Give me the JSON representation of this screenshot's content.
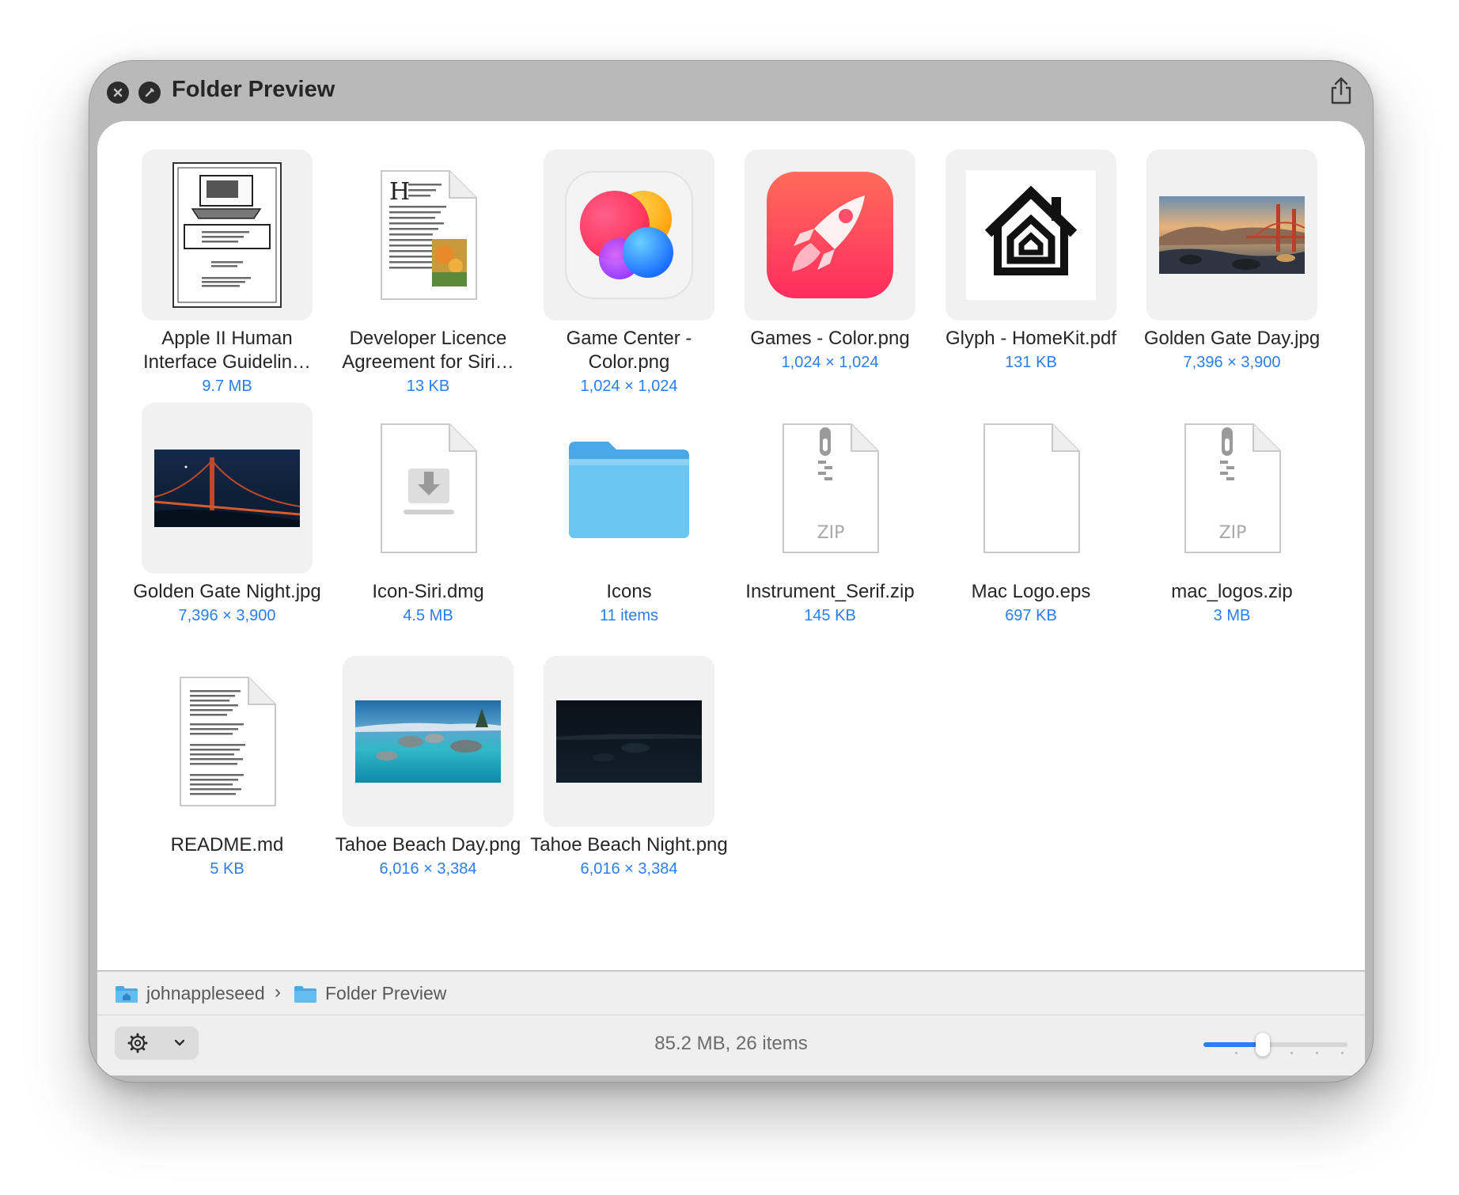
{
  "window": {
    "title": "Folder Preview"
  },
  "items": [
    {
      "name": "Apple II Human Interface Guidelin…",
      "meta": "9.7 MB",
      "icon": "document-thumbnail"
    },
    {
      "name": "Developer Licence Agreement for Siri…",
      "meta": "13 KB",
      "icon": "rich-text-document"
    },
    {
      "name": "Game Center - Color.png",
      "meta": "1,024 × 1,024",
      "icon": "game-center-icon"
    },
    {
      "name": "Games - Color.png",
      "meta": "1,024 × 1,024",
      "icon": "games-rocket-icon"
    },
    {
      "name": "Glyph - HomeKit.pdf",
      "meta": "131 KB",
      "icon": "homekit-glyph"
    },
    {
      "name": "Golden Gate Day.jpg",
      "meta": "7,396 × 3,900",
      "icon": "photo-golden-gate-day"
    },
    {
      "name": "Golden Gate Night.jpg",
      "meta": "7,396 × 3,900",
      "icon": "photo-golden-gate-night"
    },
    {
      "name": "Icon-Siri.dmg",
      "meta": "4.5 MB",
      "icon": "disk-image-icon"
    },
    {
      "name": "Icons",
      "meta": "11 items",
      "icon": "folder-icon"
    },
    {
      "name": "Instrument_Serif.zip",
      "meta": "145 KB",
      "icon": "zip-archive-icon"
    },
    {
      "name": "Mac Logo.eps",
      "meta": "697 KB",
      "icon": "blank-document-icon"
    },
    {
      "name": "mac_logos.zip",
      "meta": "3 MB",
      "icon": "zip-archive-icon"
    },
    {
      "name": "README.md",
      "meta": "5 KB",
      "icon": "text-document-icon"
    },
    {
      "name": "Tahoe Beach Day.png",
      "meta": "6,016 × 3,384",
      "icon": "photo-tahoe-day"
    },
    {
      "name": "Tahoe Beach Night.png",
      "meta": "6,016 × 3,384",
      "icon": "photo-tahoe-night"
    }
  ],
  "zip_label": "ZIP",
  "pathbar": {
    "crumbs": [
      "johnappleseed",
      "Folder Preview"
    ],
    "separator": "›"
  },
  "status": "85.2 MB, 26 items",
  "zoom_level": 0.4,
  "colors": {
    "accent": "#2a7ef0",
    "folder": "#5ab7ec"
  }
}
